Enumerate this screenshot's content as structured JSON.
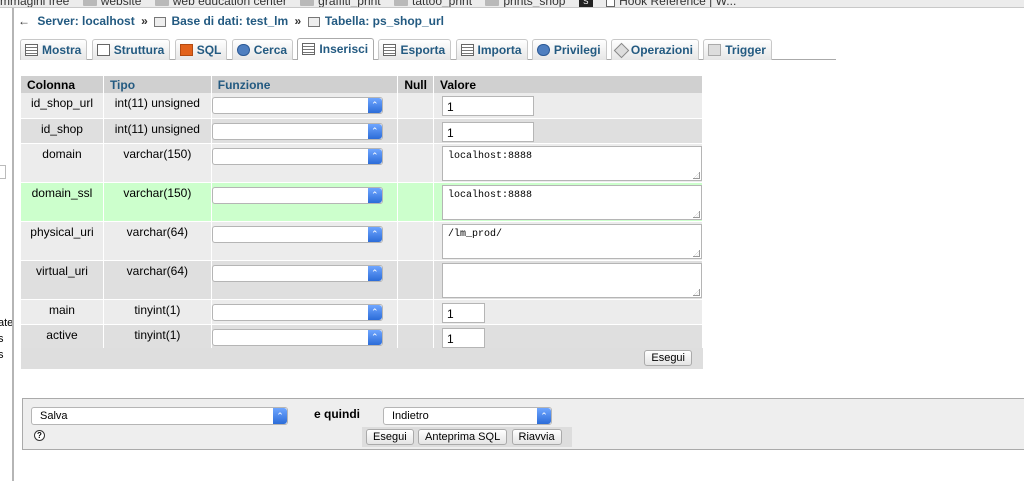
{
  "bookmarks": {
    "items": [
      "mmagini free",
      "website",
      "web education center",
      "graffiti_print",
      "tattoo_print",
      "prints_shop",
      "Hook Reference | W..."
    ]
  },
  "leftnav": {
    "fragments": [
      "ate",
      "s",
      "s"
    ]
  },
  "breadcrumb": {
    "server": "Server: localhost",
    "database": "Base di dati: test_lm",
    "table": "Tabella: ps_shop_url",
    "separator": "»"
  },
  "tabs": [
    {
      "label": "Mostra",
      "icon": "table-icon"
    },
    {
      "label": "Struttura",
      "icon": "structure-icon"
    },
    {
      "label": "SQL",
      "icon": "sql-icon"
    },
    {
      "label": "Cerca",
      "icon": "search-icon"
    },
    {
      "label": "Inserisci",
      "icon": "insert-icon"
    },
    {
      "label": "Esporta",
      "icon": "export-icon"
    },
    {
      "label": "Importa",
      "icon": "import-icon"
    },
    {
      "label": "Privilegi",
      "icon": "privileges-icon"
    },
    {
      "label": "Operazioni",
      "icon": "operations-icon"
    },
    {
      "label": "Trigger",
      "icon": "trigger-icon"
    }
  ],
  "form": {
    "headers": {
      "column": "Colonna",
      "type": "Tipo",
      "function": "Funzione",
      "null": "Null",
      "value": "Valore"
    },
    "rows": [
      {
        "column": "id_shop_url",
        "type": "int(11) unsigned",
        "value": "1"
      },
      {
        "column": "id_shop",
        "type": "int(11) unsigned",
        "value": "1"
      },
      {
        "column": "domain",
        "type": "varchar(150)",
        "value": "localhost:8888"
      },
      {
        "column": "domain_ssl",
        "type": "varchar(150)",
        "value": "localhost:8888"
      },
      {
        "column": "physical_uri",
        "type": "varchar(64)",
        "value": "/lm_prod/"
      },
      {
        "column": "virtual_uri",
        "type": "varchar(64)",
        "value": ""
      },
      {
        "column": "main",
        "type": "tinyint(1)",
        "value": "1"
      },
      {
        "column": "active",
        "type": "tinyint(1)",
        "value": "1"
      }
    ],
    "execute_label": "Esegui"
  },
  "bottom": {
    "action_select": "Salva",
    "then_label": "e quindi",
    "then_select": "Indietro",
    "help_icon": "?",
    "buttons": [
      "Esegui",
      "Anteprima SQL",
      "Riavvia"
    ]
  },
  "colors": {
    "link": "#235a81",
    "highlight_row": "#ccffcc",
    "header_bg": "#d0d0d0"
  }
}
